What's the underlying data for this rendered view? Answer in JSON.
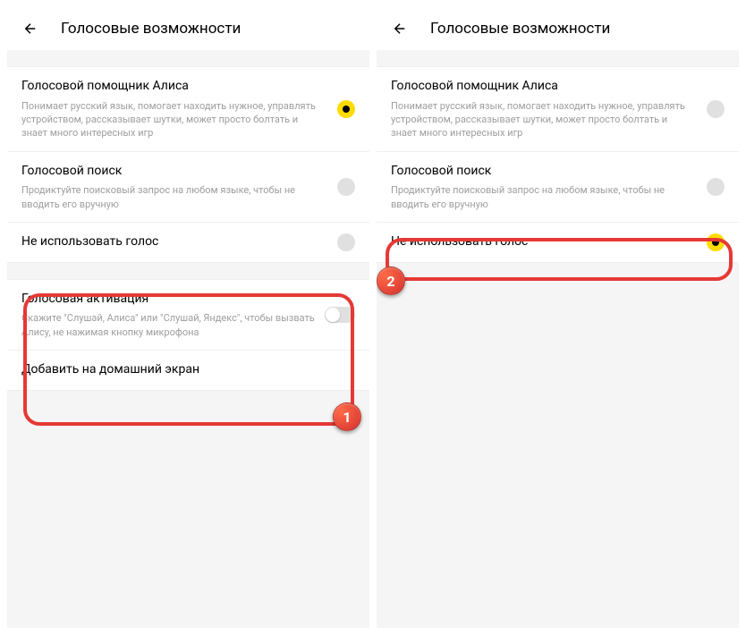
{
  "screens": {
    "left": {
      "title": "Голосовые возможности",
      "options": {
        "alisa": {
          "title": "Голосовой помощник Алиса",
          "desc": "Понимает русский язык, помогает находить нужное, управлять устройством, рассказывает шутки, может просто болтать и знает много интересных игр"
        },
        "search": {
          "title": "Голосовой поиск",
          "desc": "Продиктуйте поисковый запрос на любом языке, чтобы не вводить его вручную"
        },
        "novoice": {
          "title": "Не использовать голос"
        }
      },
      "activation": {
        "title": "Голосовая активация",
        "desc": "Скажите \"Слушай, Алиса\" или \"Слушай, Яндекс\", чтобы вызвать Алису, не нажимая кнопку микрофона"
      },
      "addhome": {
        "title": "Добавить на домашний экран"
      }
    },
    "right": {
      "title": "Голосовые возможности",
      "options": {
        "alisa": {
          "title": "Голосовой помощник Алиса",
          "desc": "Понимает русский язык, помогает находить нужное, управлять устройством, рассказывает шутки, может просто болтать и знает много интересных игр"
        },
        "search": {
          "title": "Голосовой поиск",
          "desc": "Продиктуйте поисковый запрос на любом языке, чтобы не вводить его вручную"
        },
        "novoice": {
          "title": "Не использовать голос"
        }
      }
    }
  },
  "badges": {
    "one": "1",
    "two": "2"
  }
}
